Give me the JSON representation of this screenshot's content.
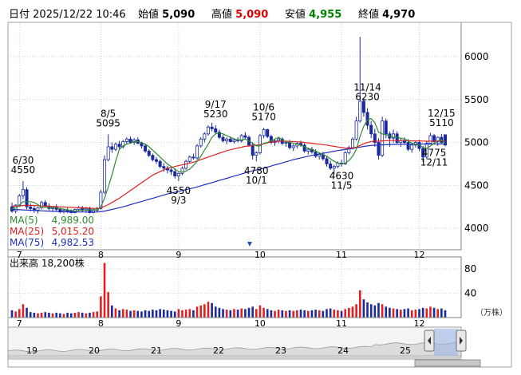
{
  "header": {
    "date_label": "日付",
    "date_value": "2025/12/22 10:46",
    "open_label": "始値",
    "open_value": "5,090",
    "high_label": "高値",
    "high_value": "5,090",
    "low_label": "安値",
    "low_value": "4,955",
    "close_label": "終値",
    "close_value": "4,970"
  },
  "colors": {
    "candle_up": "#ffffff",
    "candle_down": "#1a2a9c",
    "ma5": "#2e8b2e",
    "ma25": "#e02020",
    "ma75": "#2030c0",
    "volume_up": "#e02020",
    "volume_down": "#1a2a9c",
    "high_value": "#e00000",
    "low_value": "#008000"
  },
  "legend": [
    {
      "label": "MA(5)",
      "value": "4,989.00"
    },
    {
      "label": "MA(25)",
      "value": "5,015.20"
    },
    {
      "label": "MA(75)",
      "value": "4,982.53"
    }
  ],
  "volume_panel": {
    "title": "出来高",
    "value": "18,200株",
    "unit": "（万株）"
  },
  "navigator_labels": [
    "19",
    "20",
    "21",
    "22",
    "23",
    "24",
    "25"
  ],
  "chart_data": {
    "type": "candlestick",
    "x_ticks": [
      "7",
      "8",
      "9",
      "10",
      "11",
      "12"
    ],
    "ylim": [
      3750,
      6400
    ],
    "y_ticks": [
      4000,
      4500,
      5000,
      5500,
      6000
    ],
    "volume_ticks": [
      40,
      80
    ],
    "volume_ylim": [
      0,
      100
    ],
    "grid": true,
    "annotations": [
      {
        "date": "6/30",
        "price": "4550",
        "index": 3,
        "pos": "above"
      },
      {
        "date": "8/5",
        "price": "5095",
        "index": 26,
        "pos": "above"
      },
      {
        "date": "9/3",
        "price": "4550",
        "index": 45,
        "pos": "below"
      },
      {
        "date": "9/17",
        "price": "5230",
        "index": 55,
        "pos": "above"
      },
      {
        "date": "10/1",
        "price": "4780",
        "index": 66,
        "pos": "below"
      },
      {
        "date": "10/6",
        "price": "5170",
        "index": 68,
        "pos": "above"
      },
      {
        "date": "11/5",
        "price": "4630",
        "index": 89,
        "pos": "below"
      },
      {
        "date": "11/14",
        "price": "6230",
        "index": 96,
        "pos": "above"
      },
      {
        "date": "12/11",
        "price": "4775",
        "index": 114,
        "pos": "below"
      },
      {
        "date": "12/15",
        "price": "5110",
        "index": 116,
        "pos": "above"
      }
    ],
    "ohlc": [
      [
        4250,
        4300,
        4180,
        4200
      ],
      [
        4200,
        4280,
        4170,
        4270
      ],
      [
        4270,
        4400,
        4250,
        4380
      ],
      [
        4380,
        4550,
        4340,
        4450
      ],
      [
        4450,
        4480,
        4220,
        4250
      ],
      [
        4250,
        4290,
        4200,
        4230
      ],
      [
        4230,
        4260,
        4180,
        4210
      ],
      [
        4210,
        4250,
        4160,
        4240
      ],
      [
        4240,
        4320,
        4220,
        4300
      ],
      [
        4300,
        4330,
        4250,
        4260
      ],
      [
        4260,
        4290,
        4210,
        4230
      ],
      [
        4230,
        4260,
        4190,
        4250
      ],
      [
        4250,
        4280,
        4200,
        4220
      ],
      [
        4220,
        4240,
        4170,
        4190
      ],
      [
        4190,
        4230,
        4160,
        4210
      ],
      [
        4210,
        4240,
        4180,
        4200
      ],
      [
        4200,
        4220,
        4150,
        4180
      ],
      [
        4180,
        4230,
        4160,
        4220
      ],
      [
        4220,
        4260,
        4200,
        4240
      ],
      [
        4240,
        4260,
        4190,
        4210
      ],
      [
        4210,
        4250,
        4180,
        4230
      ],
      [
        4230,
        4250,
        4160,
        4180
      ],
      [
        4180,
        4230,
        4150,
        4210
      ],
      [
        4210,
        4250,
        4190,
        4230
      ],
      [
        4230,
        4450,
        4220,
        4420
      ],
      [
        4420,
        4850,
        4400,
        4800
      ],
      [
        4800,
        5095,
        4780,
        4950
      ],
      [
        4950,
        5000,
        4880,
        4920
      ],
      [
        4920,
        5000,
        4900,
        4980
      ],
      [
        4980,
        5020,
        4920,
        4950
      ],
      [
        4950,
        5030,
        4930,
        5010
      ],
      [
        5010,
        5060,
        4980,
        5040
      ],
      [
        5040,
        5070,
        4990,
        5000
      ],
      [
        5000,
        5050,
        4970,
        5030
      ],
      [
        5030,
        5060,
        4980,
        4990
      ],
      [
        4990,
        5010,
        4930,
        4960
      ],
      [
        4960,
        4980,
        4880,
        4900
      ],
      [
        4900,
        4920,
        4830,
        4850
      ],
      [
        4850,
        4870,
        4780,
        4800
      ],
      [
        4800,
        4830,
        4750,
        4780
      ],
      [
        4780,
        4800,
        4700,
        4720
      ],
      [
        4720,
        4760,
        4660,
        4700
      ],
      [
        4700,
        4730,
        4640,
        4680
      ],
      [
        4680,
        4720,
        4620,
        4660
      ],
      [
        4660,
        4700,
        4580,
        4610
      ],
      [
        4610,
        4650,
        4550,
        4640
      ],
      [
        4640,
        4720,
        4620,
        4700
      ],
      [
        4700,
        4800,
        4680,
        4780
      ],
      [
        4780,
        4850,
        4760,
        4830
      ],
      [
        4830,
        4870,
        4800,
        4820
      ],
      [
        4820,
        4980,
        4800,
        4960
      ],
      [
        4960,
        5060,
        4940,
        5040
      ],
      [
        5040,
        5120,
        5000,
        5100
      ],
      [
        5100,
        5200,
        5080,
        5180
      ],
      [
        5180,
        5230,
        5130,
        5160
      ],
      [
        5160,
        5200,
        5100,
        5120
      ],
      [
        5120,
        5150,
        5040,
        5060
      ],
      [
        5060,
        5090,
        5000,
        5020
      ],
      [
        5020,
        5060,
        4980,
        5040
      ],
      [
        5040,
        5070,
        5000,
        5010
      ],
      [
        5010,
        5050,
        4990,
        5030
      ],
      [
        5030,
        5060,
        5000,
        5020
      ],
      [
        5020,
        5100,
        5000,
        5080
      ],
      [
        5080,
        5120,
        5040,
        5060
      ],
      [
        5060,
        5080,
        4950,
        4970
      ],
      [
        4970,
        5000,
        4800,
        4850
      ],
      [
        4850,
        4900,
        4780,
        4880
      ],
      [
        4880,
        5100,
        4860,
        5080
      ],
      [
        5080,
        5170,
        5050,
        5150
      ],
      [
        5150,
        5160,
        5050,
        5070
      ],
      [
        5070,
        5090,
        4980,
        5000
      ],
      [
        5000,
        5040,
        4960,
        5020
      ],
      [
        5020,
        5060,
        4990,
        5040
      ],
      [
        5040,
        5060,
        4970,
        4990
      ],
      [
        4990,
        5020,
        4950,
        5000
      ],
      [
        5000,
        5030,
        4920,
        4940
      ],
      [
        4940,
        4980,
        4900,
        4960
      ],
      [
        4960,
        5000,
        4930,
        4990
      ],
      [
        4990,
        5020,
        4950,
        4970
      ],
      [
        4970,
        4990,
        4880,
        4900
      ],
      [
        4900,
        4940,
        4860,
        4920
      ],
      [
        4920,
        4950,
        4870,
        4890
      ],
      [
        4890,
        4920,
        4820,
        4840
      ],
      [
        4840,
        4880,
        4800,
        4860
      ],
      [
        4860,
        4890,
        4790,
        4810
      ],
      [
        4810,
        4840,
        4720,
        4750
      ],
      [
        4750,
        4790,
        4680,
        4700
      ],
      [
        4700,
        4740,
        4630,
        4720
      ],
      [
        4720,
        4780,
        4700,
        4760
      ],
      [
        4760,
        4800,
        4720,
        4750
      ],
      [
        4750,
        4900,
        4740,
        4880
      ],
      [
        4880,
        4960,
        4860,
        4940
      ],
      [
        4940,
        5060,
        4920,
        5040
      ],
      [
        5040,
        5300,
        5020,
        5250
      ],
      [
        5250,
        6230,
        5230,
        5480
      ],
      [
        5480,
        5520,
        5300,
        5350
      ],
      [
        5350,
        5400,
        5150,
        5200
      ],
      [
        5200,
        5250,
        5050,
        5100
      ],
      [
        5100,
        5160,
        4950,
        5000
      ],
      [
        5000,
        5050,
        4800,
        4850
      ],
      [
        4850,
        5300,
        4830,
        5250
      ],
      [
        5250,
        5280,
        5050,
        5100
      ],
      [
        5100,
        5130,
        4950,
        5050
      ],
      [
        5050,
        5150,
        5000,
        5100
      ],
      [
        5100,
        5130,
        4980,
        5000
      ],
      [
        5000,
        5050,
        4950,
        5020
      ],
      [
        5020,
        5060,
        4970,
        5000
      ],
      [
        5000,
        5040,
        4900,
        4920
      ],
      [
        4920,
        4990,
        4880,
        4970
      ],
      [
        4970,
        5020,
        4940,
        5000
      ],
      [
        5000,
        5030,
        4900,
        4930
      ],
      [
        4930,
        4960,
        4775,
        4830
      ],
      [
        4830,
        5010,
        4810,
        4990
      ],
      [
        4990,
        5110,
        4980,
        5080
      ],
      [
        5080,
        5100,
        4990,
        5010
      ],
      [
        5010,
        5070,
        4960,
        5060
      ],
      [
        5060,
        5100,
        4980,
        5000
      ],
      [
        5090,
        5090,
        4955,
        4970
      ]
    ],
    "ma5": [
      4230,
      4235,
      4270,
      4310,
      4310,
      4310,
      4300,
      4275,
      4240,
      4245,
      4240,
      4240,
      4240,
      4230,
      4222,
      4215,
      4208,
      4200,
      4208,
      4210,
      4215,
      4218,
      4215,
      4215,
      4250,
      4350,
      4480,
      4620,
      4780,
      4920,
      4960,
      4980,
      4990,
      5010,
      5010,
      5000,
      4980,
      4950,
      4910,
      4870,
      4830,
      4790,
      4750,
      4720,
      4690,
      4660,
      4655,
      4665,
      4690,
      4730,
      4780,
      4840,
      4910,
      4980,
      5060,
      5100,
      5110,
      5100,
      5080,
      5060,
      5040,
      5030,
      5030,
      5040,
      5020,
      4990,
      4960,
      4960,
      4990,
      5000,
      5020,
      5040,
      5060,
      5030,
      5010,
      5000,
      4990,
      4980,
      4970,
      4950,
      4930,
      4920,
      4900,
      4880,
      4860,
      4840,
      4810,
      4780,
      4760,
      4750,
      4760,
      4790,
      4840,
      4920,
      5070,
      5190,
      5260,
      5280,
      5230,
      5120,
      5100,
      5090,
      5080,
      5060,
      5060,
      5050,
      5040,
      5020,
      4990,
      4980,
      4970,
      4940,
      4930,
      4960,
      4990,
      5010,
      5030,
      4989
    ],
    "ma25": [
      4260,
      4258,
      4260,
      4265,
      4268,
      4268,
      4266,
      4262,
      4260,
      4258,
      4256,
      4254,
      4252,
      4250,
      4248,
      4246,
      4244,
      4242,
      4240,
      4238,
      4236,
      4234,
      4232,
      4230,
      4240,
      4255,
      4275,
      4300,
      4325,
      4350,
      4380,
      4410,
      4440,
      4470,
      4500,
      4530,
      4560,
      4590,
      4620,
      4640,
      4660,
      4680,
      4700,
      4710,
      4720,
      4730,
      4740,
      4750,
      4760,
      4770,
      4785,
      4800,
      4815,
      4830,
      4845,
      4860,
      4875,
      4890,
      4905,
      4915,
      4925,
      4935,
      4945,
      4955,
      4960,
      4965,
      4970,
      4975,
      4985,
      4995,
      5005,
      5010,
      5015,
      5015,
      5015,
      5012,
      5010,
      5008,
      5005,
      5000,
      4995,
      4990,
      4985,
      4980,
      4975,
      4970,
      4962,
      4955,
      4948,
      4940,
      4935,
      4932,
      4935,
      4945,
      4965,
      4985,
      5000,
      5010,
      5015,
      5015,
      5018,
      5020,
      5022,
      5022,
      5022,
      5022,
      5022,
      5020,
      5018,
      5018,
      5018,
      5016,
      5015,
      5015,
      5016,
      5017,
      5018,
      5015.2
    ],
    "ma75": [
      4220,
      4218,
      4216,
      4214,
      4212,
      4210,
      4208,
      4206,
      4204,
      4202,
      4200,
      4198,
      4196,
      4194,
      4193,
      4192,
      4191,
      4190,
      4190,
      4190,
      4190,
      4190,
      4190,
      4190,
      4195,
      4200,
      4210,
      4220,
      4230,
      4240,
      4250,
      4262,
      4275,
      4288,
      4300,
      4312,
      4325,
      4338,
      4350,
      4362,
      4375,
      4388,
      4400,
      4410,
      4420,
      4430,
      4440,
      4450,
      4460,
      4470,
      4482,
      4495,
      4508,
      4520,
      4532,
      4545,
      4558,
      4570,
      4582,
      4595,
      4608,
      4620,
      4632,
      4645,
      4658,
      4670,
      4680,
      4690,
      4700,
      4712,
      4725,
      4738,
      4750,
      4762,
      4775,
      4788,
      4800,
      4810,
      4820,
      4830,
      4840,
      4850,
      4858,
      4866,
      4874,
      4882,
      4890,
      4898,
      4906,
      4912,
      4918,
      4924,
      4930,
      4938,
      4946,
      4954,
      4960,
      4965,
      4968,
      4970,
      4972,
      4974,
      4976,
      4977,
      4978,
      4979,
      4980,
      4980,
      4980,
      4981,
      4981,
      4982,
      4982,
      4982,
      4982,
      4982,
      4983,
      4982.53
    ],
    "volume": [
      12,
      10,
      14,
      22,
      16,
      9,
      8,
      7,
      8,
      9,
      8,
      7,
      8,
      7,
      6,
      8,
      7,
      8,
      9,
      8,
      7,
      8,
      9,
      10,
      35,
      90,
      42,
      20,
      15,
      12,
      14,
      13,
      11,
      12,
      11,
      10,
      12,
      11,
      13,
      12,
      14,
      13,
      12,
      11,
      10,
      14,
      12,
      13,
      14,
      12,
      18,
      20,
      22,
      26,
      24,
      18,
      16,
      14,
      13,
      12,
      14,
      13,
      15,
      14,
      16,
      18,
      14,
      20,
      16,
      14,
      12,
      11,
      13,
      12,
      11,
      12,
      11,
      12,
      13,
      12,
      11,
      12,
      13,
      12,
      11,
      14,
      15,
      13,
      12,
      11,
      14,
      16,
      18,
      22,
      45,
      30,
      25,
      22,
      20,
      24,
      22,
      18,
      16,
      15,
      14,
      13,
      14,
      15,
      12,
      13,
      14,
      16,
      15,
      18,
      16,
      14,
      15,
      12
    ]
  }
}
